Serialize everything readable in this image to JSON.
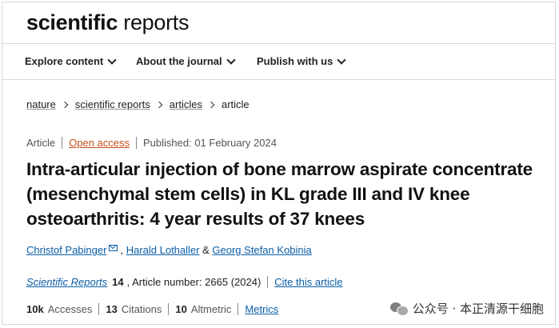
{
  "brand": {
    "part1": "scientific",
    "part2": " reports"
  },
  "nav": {
    "items": [
      {
        "label": "Explore content"
      },
      {
        "label": "About the journal"
      },
      {
        "label": "Publish with us"
      }
    ]
  },
  "breadcrumb": {
    "items": [
      "nature",
      "scientific reports",
      "articles",
      "article"
    ]
  },
  "meta": {
    "type": "Article",
    "access": "Open access",
    "published": "Published: 01 February 2024"
  },
  "article": {
    "title": "Intra-articular injection of bone marrow aspirate concentrate (mesenchymal stem cells) in KL grade III and IV knee osteoarthritis: 4 year results of 37 knees",
    "authors": [
      "Christof Pabinger",
      "Harald Lothaller",
      "Georg Stefan Kobinia"
    ],
    "author_sep": ",",
    "author_and": "&"
  },
  "citation": {
    "journal": "Scientific Reports",
    "volume": "14",
    "rest": ", Article number: 2665 (2024)",
    "cite_link": "Cite this article"
  },
  "metrics": {
    "accesses_num": "10k",
    "accesses_label": "Accesses",
    "citations_num": "13",
    "citations_label": "Citations",
    "altmetric_num": "10",
    "altmetric_label": "Altmetric",
    "metrics_link": "Metrics"
  },
  "watermark": {
    "text": "公众号 · 本正清源干细胞"
  },
  "colors": {
    "link": "#0b5ea8",
    "open_access": "#c74f1b"
  }
}
